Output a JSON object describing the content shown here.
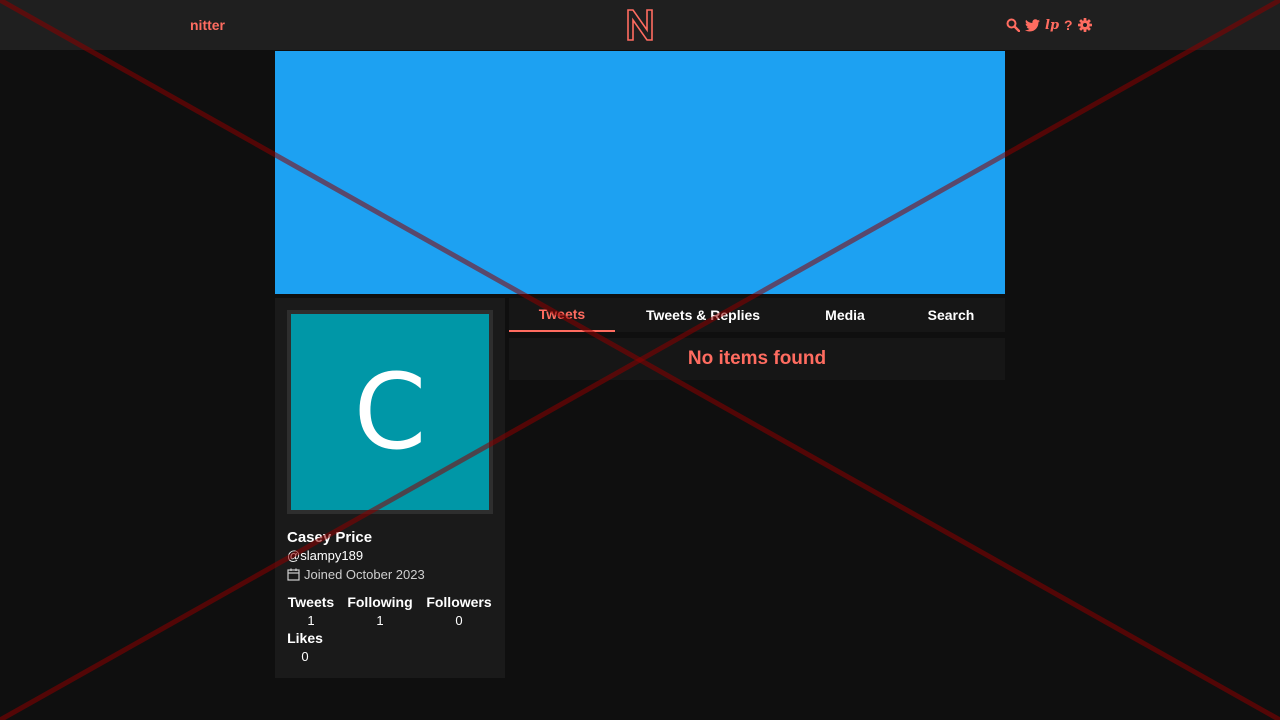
{
  "navbar": {
    "brand": "nitter",
    "icons": [
      "search-icon",
      "twitter-bird-icon",
      "rss-icon",
      "help-icon",
      "gear-icon"
    ],
    "rss_label": "lp",
    "help_label": "?"
  },
  "banner": {
    "color": "#1da1f2"
  },
  "profile": {
    "avatar_letter": "C",
    "avatar_color": "#0097a7",
    "fullname": "Casey Price",
    "username": "@slampy189",
    "join_date": "Joined October 2023",
    "stats": {
      "tweets": {
        "label": "Tweets",
        "value": "1"
      },
      "following": {
        "label": "Following",
        "value": "1"
      },
      "followers": {
        "label": "Followers",
        "value": "0"
      },
      "likes": {
        "label": "Likes",
        "value": "0"
      }
    }
  },
  "tabs": [
    {
      "label": "Tweets",
      "active": true
    },
    {
      "label": "Tweets & Replies",
      "active": false
    },
    {
      "label": "Media",
      "active": false
    },
    {
      "label": "Search",
      "active": false
    }
  ],
  "timeline": {
    "empty_message": "No items found"
  },
  "colors": {
    "accent": "#ff6c60",
    "overlay_cross": "#8b0000"
  }
}
